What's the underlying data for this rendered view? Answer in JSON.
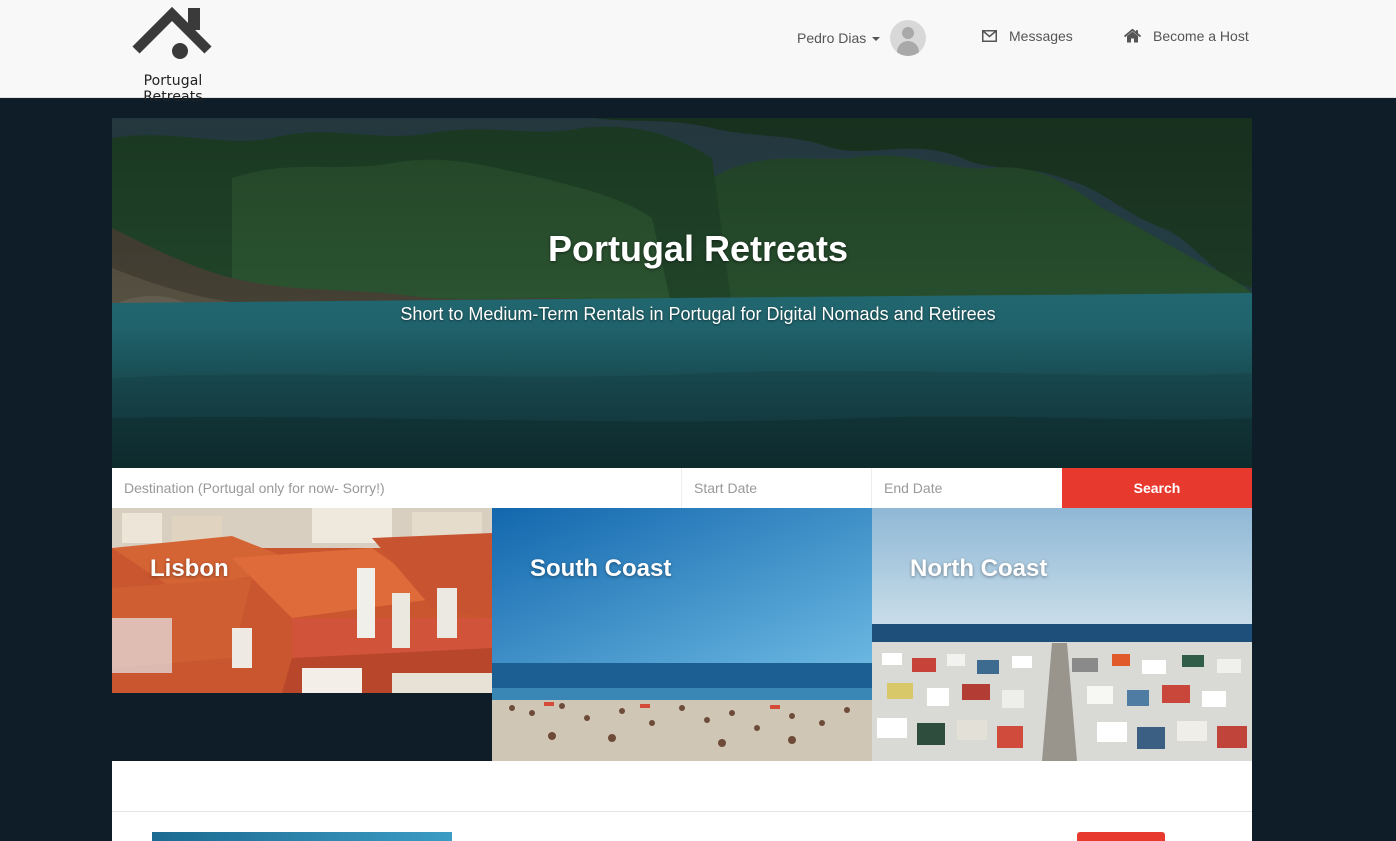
{
  "header": {
    "logo_text": "Portugal Retreats",
    "user_name": "Pedro Dias",
    "messages_label": "Messages",
    "host_label": "Become a Host"
  },
  "hero": {
    "title": "Portugal Retreats",
    "subtitle": "Short to Medium-Term Rentals in Portugal for Digital Nomads and Retirees"
  },
  "search": {
    "destination_placeholder": "Destination (Portugal only for now- Sorry!)",
    "start_placeholder": "Start Date",
    "end_placeholder": "End Date",
    "button_label": "Search"
  },
  "destinations": [
    {
      "label": "Lisbon"
    },
    {
      "label": "South Coast"
    },
    {
      "label": "North Coast"
    }
  ],
  "colors": {
    "accent": "#e8392f",
    "page_background": "#0e1d27",
    "header_background": "#f8f8f8"
  },
  "icons": {
    "logo": "house-icon",
    "messages": "envelope-icon",
    "host": "home-icon",
    "user": "avatar-icon"
  }
}
